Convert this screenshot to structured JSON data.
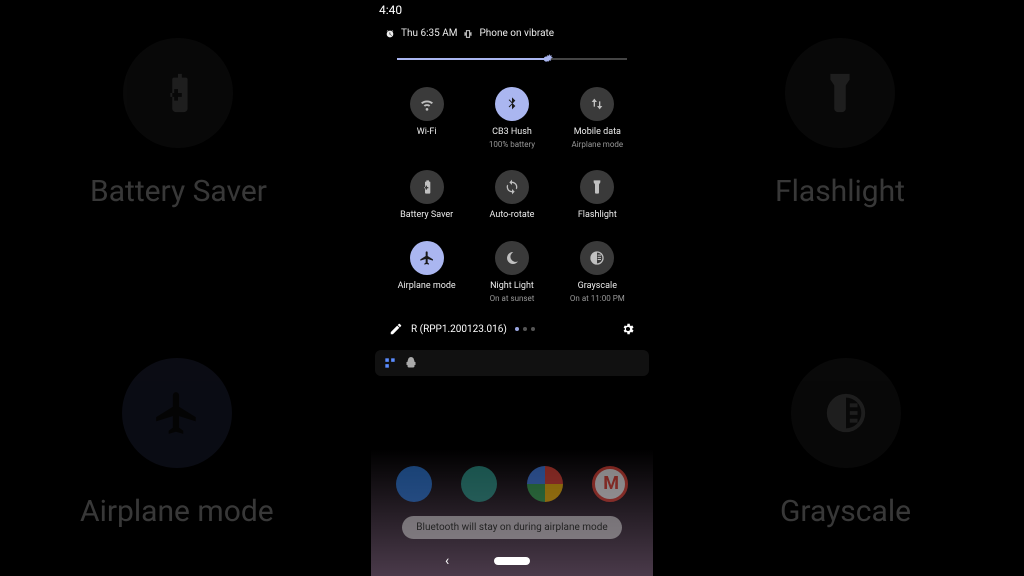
{
  "statusbar": {
    "time": "4:40"
  },
  "qs_header": {
    "alarm_time": "Thu 6:35 AM",
    "ringer_status": "Phone on vibrate"
  },
  "brightness": {
    "percent": 66
  },
  "tiles": [
    {
      "id": "wifi",
      "label": "Wi-Fi",
      "sub": "",
      "active": false
    },
    {
      "id": "bluetooth",
      "label": "CB3 Hush",
      "sub": "100% battery",
      "active": true
    },
    {
      "id": "mobiledata",
      "label": "Mobile data",
      "sub": "Airplane mode",
      "active": false
    },
    {
      "id": "batterysaver",
      "label": "Battery Saver",
      "sub": "",
      "active": false
    },
    {
      "id": "autorotate",
      "label": "Auto-rotate",
      "sub": "",
      "active": false
    },
    {
      "id": "flashlight",
      "label": "Flashlight",
      "sub": "",
      "active": false
    },
    {
      "id": "airplane",
      "label": "Airplane mode",
      "sub": "",
      "active": true
    },
    {
      "id": "nightlight",
      "label": "Night Light",
      "sub": "On at sunset",
      "active": false
    },
    {
      "id": "grayscale",
      "label": "Grayscale",
      "sub": "On at 11:00 PM",
      "active": false
    }
  ],
  "qs_footer": {
    "build": "R (RPP1.200123.016)"
  },
  "toast": {
    "text": "Bluetooth will stay on during airplane mode"
  },
  "bg": {
    "tl_label": "Battery Saver",
    "tr_label": "Flashlight",
    "bl_label": "Airplane mode",
    "br_label": "Grayscale"
  }
}
